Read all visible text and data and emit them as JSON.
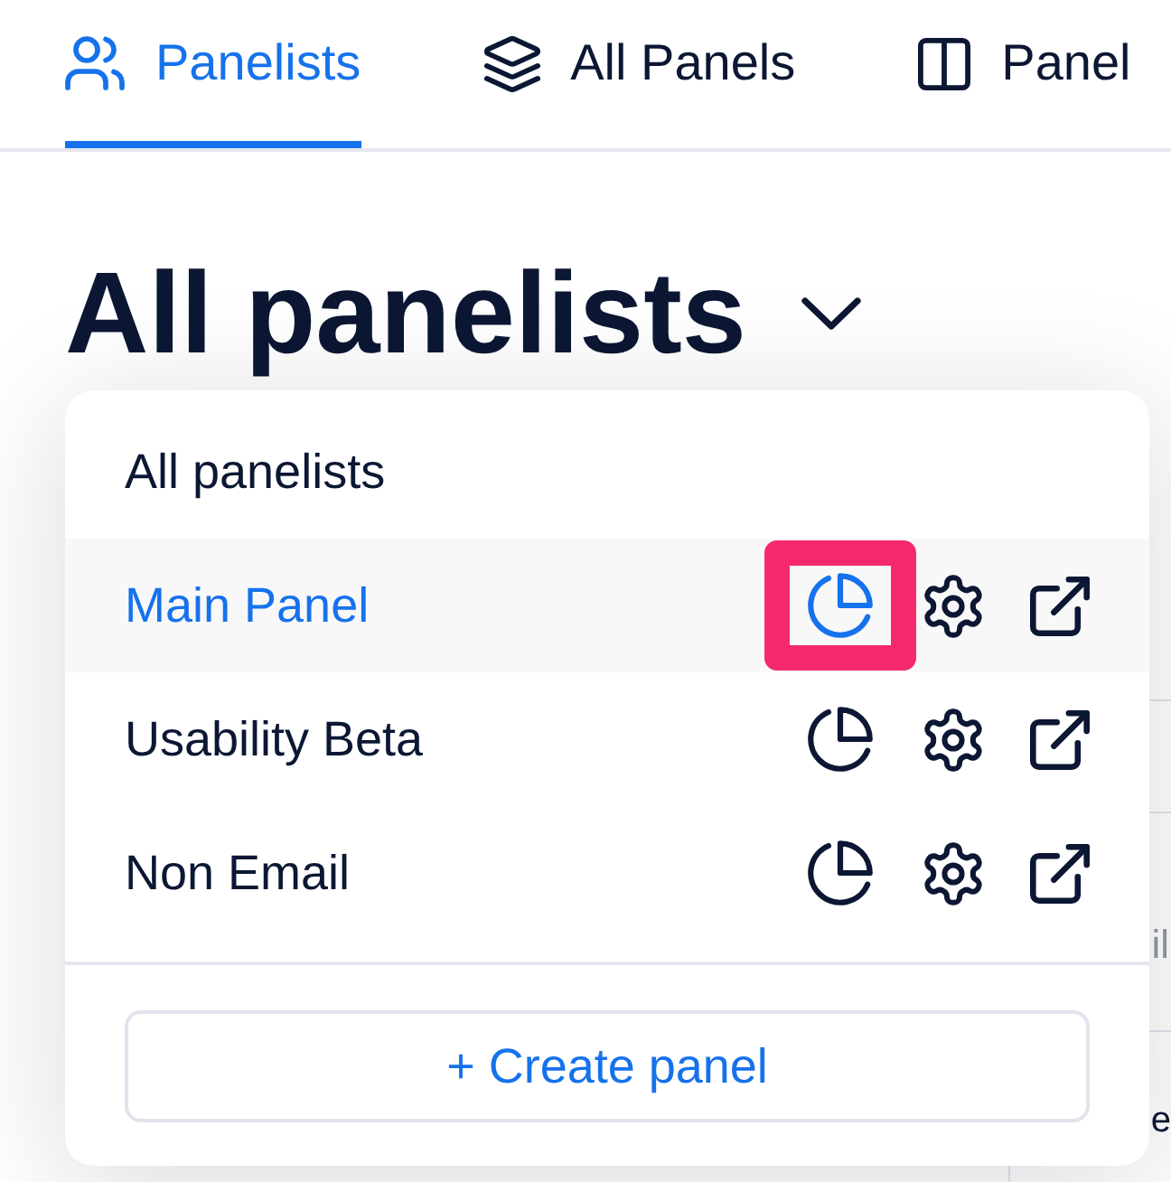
{
  "tabs": [
    {
      "label": "Panelists",
      "selected": true
    },
    {
      "label": "All Panels",
      "selected": false
    },
    {
      "label": "Panel",
      "selected": false
    }
  ],
  "title": "All panelists",
  "menu": {
    "all_item": {
      "label": "All panelists",
      "selected": false
    },
    "panels": [
      {
        "name": "Main Panel",
        "selected": true,
        "highlighted": true
      },
      {
        "name": "Usability Beta",
        "selected": false,
        "highlighted": false
      },
      {
        "name": "Non Email",
        "selected": false,
        "highlighted": false
      }
    ],
    "create_button": "+ Create panel"
  },
  "background_table": {
    "fragments": [
      "il",
      "e"
    ]
  }
}
